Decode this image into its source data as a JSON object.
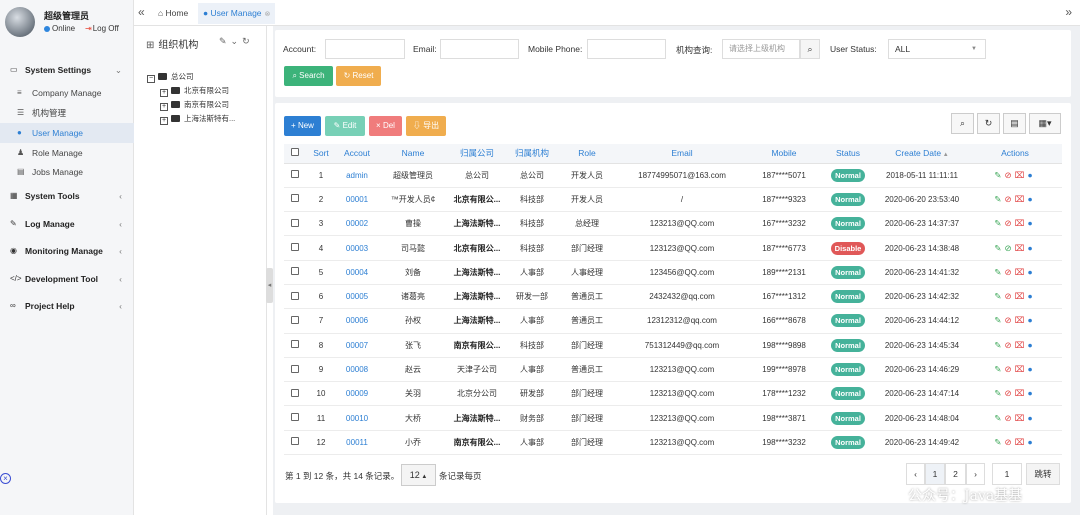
{
  "user": {
    "name": "超级管理员",
    "online": "Online",
    "logoff": "Log Off"
  },
  "menu": {
    "system_settings": "System Settings",
    "company_manage": "Company Manage",
    "org_manage": "机构管理",
    "user_manage": "User Manage",
    "role_manage": "Role Manage",
    "jobs_manage": "Jobs Manage",
    "system_tools": "System Tools",
    "log_manage": "Log Manage",
    "monitoring_manage": "Monitoring Manage",
    "development_tool": "Development Tool",
    "project_help": "Project Help"
  },
  "tabs": {
    "home": "Home",
    "user_manage": "User Manage"
  },
  "tree": {
    "title": "组织机构",
    "root": "总公司",
    "children": [
      "北京有限公司",
      "南京有限公司",
      "上海法斯特有..."
    ]
  },
  "search": {
    "account_label": "Account:",
    "email_label": "Email:",
    "phone_label": "Mobile Phone:",
    "org_label": "机构查询:",
    "org_placeholder": "请选择上级机构",
    "status_label": "User Status:",
    "status_value": "ALL",
    "search_btn": "Search",
    "reset_btn": "Reset"
  },
  "toolbar": {
    "new": "New",
    "edit": "Edit",
    "del": "Del",
    "export": "导出"
  },
  "table": {
    "headers": [
      "Sort",
      "Accout",
      "Name",
      "归属公司",
      "归属机构",
      "Role",
      "Email",
      "Mobile",
      "Status",
      "Create Date",
      "Actions"
    ],
    "rows": [
      [
        "1",
        "admin",
        "超级管理员",
        "总公司",
        "总公司",
        "开发人员",
        "18774995071@163.com",
        "187****5071",
        "Normal",
        "2018-05-11 11:11:11"
      ],
      [
        "2",
        "00001",
        "™开发人员¢",
        "北京有限公...",
        "科技部",
        "开发人员",
        "/",
        "187****9323",
        "Normal",
        "2020-06-20 23:53:40"
      ],
      [
        "3",
        "00002",
        "曹操",
        "上海法斯特...",
        "科技部",
        "总经理",
        "123213@QQ.com",
        "167****3232",
        "Normal",
        "2020-06-23 14:37:37"
      ],
      [
        "4",
        "00003",
        "司马懿",
        "北京有限公...",
        "科技部",
        "部门经理",
        "123123@QQ.com",
        "187****6773",
        "Disable",
        "2020-06-23 14:38:48"
      ],
      [
        "5",
        "00004",
        "刘备",
        "上海法斯特...",
        "人事部",
        "人事经理",
        "123456@QQ.com",
        "189****2131",
        "Normal",
        "2020-06-23 14:41:32"
      ],
      [
        "6",
        "00005",
        "诸葛亮",
        "上海法斯特...",
        "研发一部",
        "普通员工",
        "2432432@qq.com",
        "167****1312",
        "Normal",
        "2020-06-23 14:42:32"
      ],
      [
        "7",
        "00006",
        "孙权",
        "上海法斯特...",
        "人事部",
        "普通员工",
        "12312312@qq.com",
        "166****8678",
        "Normal",
        "2020-06-23 14:44:12"
      ],
      [
        "8",
        "00007",
        "张飞",
        "南京有限公...",
        "科技部",
        "部门经理",
        "751312449@qq.com",
        "198****9898",
        "Normal",
        "2020-06-23 14:45:34"
      ],
      [
        "9",
        "00008",
        "赵云",
        "天津子公司",
        "人事部",
        "普通员工",
        "123213@QQ.com",
        "199****8978",
        "Normal",
        "2020-06-23 14:46:29"
      ],
      [
        "10",
        "00009",
        "关羽",
        "北京分公司",
        "研发部",
        "部门经理",
        "123213@QQ.com",
        "178****1232",
        "Normal",
        "2020-06-23 14:47:14"
      ],
      [
        "11",
        "00010",
        "大桥",
        "上海法斯特...",
        "财务部",
        "部门经理",
        "123213@QQ.com",
        "198****3871",
        "Normal",
        "2020-06-23 14:48:04"
      ],
      [
        "12",
        "00011",
        "小乔",
        "南京有限公...",
        "人事部",
        "部门经理",
        "123213@QQ.com",
        "198****3232",
        "Normal",
        "2020-06-23 14:49:42"
      ]
    ]
  },
  "pagination": {
    "info": "第 1 到 12 条，共 14 条记录。",
    "page_size": "12",
    "suffix": "条记录每页",
    "pages": [
      "‹",
      "1",
      "2",
      "›"
    ],
    "jump_value": "1",
    "jump_btn": "跳转"
  },
  "watermark": "公众号：Java基基",
  "colors": {
    "accent": "#2d7fd3",
    "new_btn": "#2d7fd3",
    "edit_btn": "#77d0b6",
    "del_btn": "#f07c7c",
    "export_btn": "#f0ad4e",
    "search_btn": "#3cb37a",
    "reset_btn": "#f0ad4e",
    "normal": "#45b29a",
    "disable": "#e05858"
  }
}
